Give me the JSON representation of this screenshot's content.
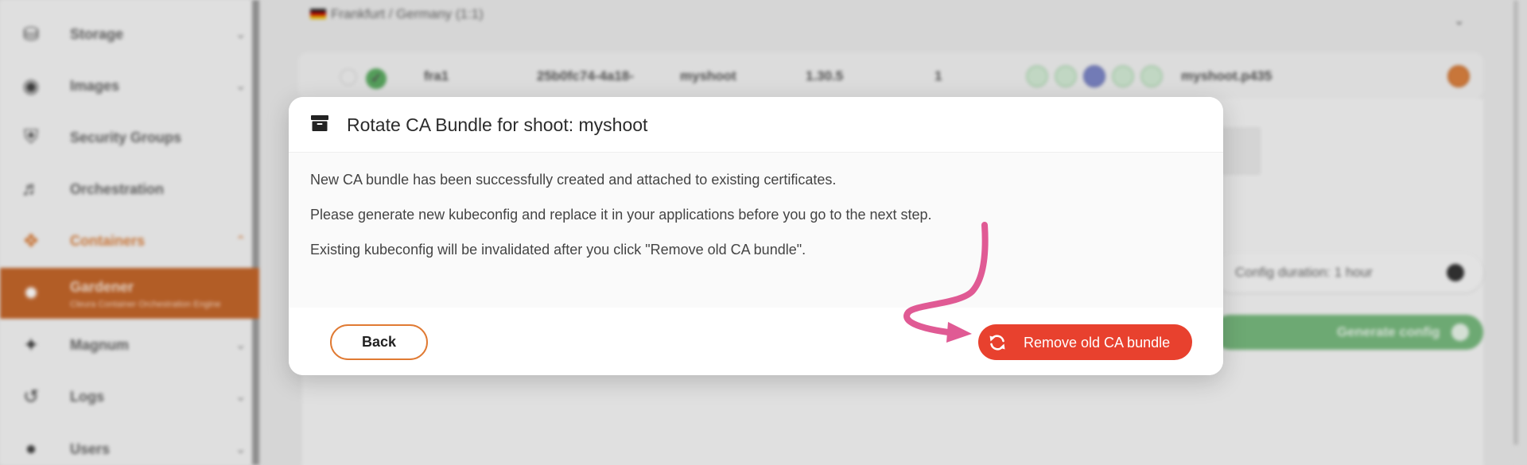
{
  "sidebar": {
    "items": [
      {
        "label": "Storage",
        "icon": "database-icon"
      },
      {
        "label": "Images",
        "icon": "camera-icon"
      },
      {
        "label": "Security Groups",
        "icon": "shield-icon"
      },
      {
        "label": "Orchestration",
        "icon": "orchestration-icon"
      },
      {
        "label": "Containers",
        "icon": "cube-icon"
      },
      {
        "label": "Gardener",
        "sublabel": "Cleura Container Orchestration Engine",
        "icon": "gardener-icon"
      },
      {
        "label": "Magnum",
        "icon": "magnum-icon"
      },
      {
        "label": "Logs",
        "icon": "history-icon"
      },
      {
        "label": "Users",
        "icon": "user-icon"
      }
    ]
  },
  "background": {
    "region": "Frankfurt / Germany (1:1)",
    "shoot": {
      "name": "fra1",
      "uuid": "25b0fc74-4a18-",
      "project": "myshoot",
      "version": "1.30.5",
      "warnings": "1",
      "domain": "myshoot.p435"
    },
    "config_duration": "Config duration: 1 hour",
    "generate_label": "Generate config"
  },
  "modal": {
    "title": "Rotate CA Bundle for shoot: myshoot",
    "lines": [
      "New CA bundle has been successfully created and attached to existing certificates.",
      "Please generate new kubeconfig and replace it in your applications before you go to the next step.",
      "Existing kubeconfig will be invalidated after you click \"Remove old CA bundle\"."
    ],
    "back_label": "Back",
    "remove_label": "Remove old CA bundle"
  },
  "colors": {
    "accent_orange": "#e07a33",
    "danger_red": "#e8412e",
    "annotation_pink": "#e05a94",
    "success_green": "#5cab62"
  }
}
